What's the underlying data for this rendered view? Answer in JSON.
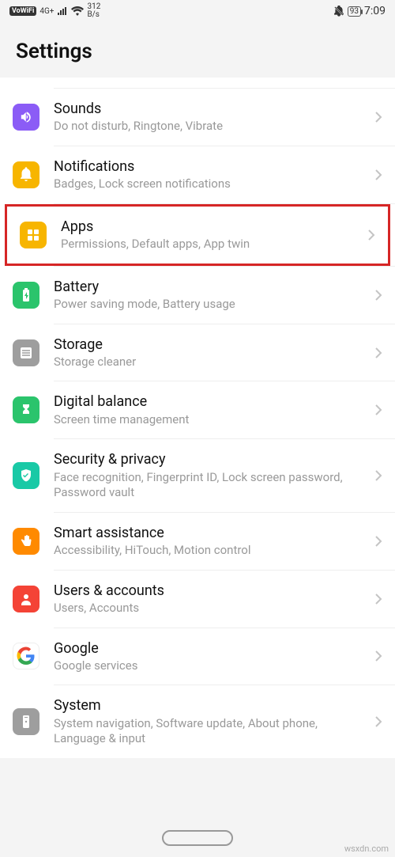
{
  "status": {
    "vowifi": "VoWiFi",
    "net": "4G+",
    "speed_top": "312",
    "speed_bot": "B/s",
    "battery": "93",
    "time": "7:09"
  },
  "header": {
    "title": "Settings"
  },
  "rows": [
    {
      "title": "Sounds",
      "sub": "Do not disturb, Ringtone, Vibrate"
    },
    {
      "title": "Notifications",
      "sub": "Badges, Lock screen notifications"
    },
    {
      "title": "Apps",
      "sub": "Permissions, Default apps, App twin"
    },
    {
      "title": "Battery",
      "sub": "Power saving mode, Battery usage"
    },
    {
      "title": "Storage",
      "sub": "Storage cleaner"
    },
    {
      "title": "Digital balance",
      "sub": "Screen time management"
    },
    {
      "title": "Security & privacy",
      "sub": "Face recognition, Fingerprint ID, Lock screen password, Password vault"
    },
    {
      "title": "Smart assistance",
      "sub": "Accessibility, HiTouch, Motion control"
    },
    {
      "title": "Users & accounts",
      "sub": "Users, Accounts"
    },
    {
      "title": "Google",
      "sub": "Google services"
    },
    {
      "title": "System",
      "sub": "System navigation, Software update, About phone, Language & input"
    }
  ],
  "watermark": "wsxdn.com"
}
